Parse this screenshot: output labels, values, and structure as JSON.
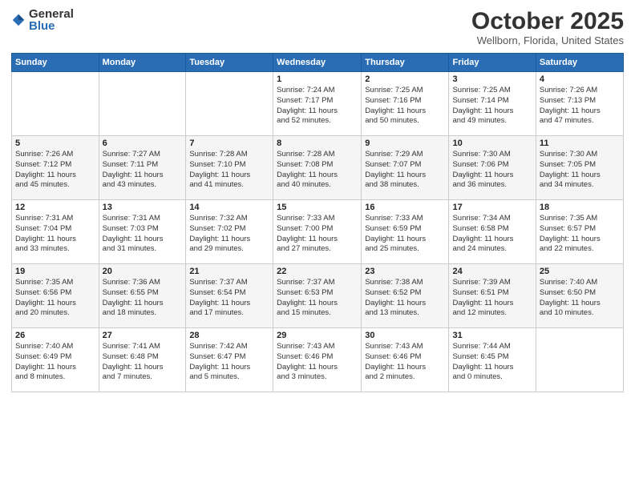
{
  "header": {
    "logo_general": "General",
    "logo_blue": "Blue",
    "month_title": "October 2025",
    "location": "Wellborn, Florida, United States"
  },
  "days_of_week": [
    "Sunday",
    "Monday",
    "Tuesday",
    "Wednesday",
    "Thursday",
    "Friday",
    "Saturday"
  ],
  "weeks": [
    {
      "cells": [
        {
          "day": "",
          "info": ""
        },
        {
          "day": "",
          "info": ""
        },
        {
          "day": "",
          "info": ""
        },
        {
          "day": "1",
          "info": "Sunrise: 7:24 AM\nSunset: 7:17 PM\nDaylight: 11 hours\nand 52 minutes."
        },
        {
          "day": "2",
          "info": "Sunrise: 7:25 AM\nSunset: 7:16 PM\nDaylight: 11 hours\nand 50 minutes."
        },
        {
          "day": "3",
          "info": "Sunrise: 7:25 AM\nSunset: 7:14 PM\nDaylight: 11 hours\nand 49 minutes."
        },
        {
          "day": "4",
          "info": "Sunrise: 7:26 AM\nSunset: 7:13 PM\nDaylight: 11 hours\nand 47 minutes."
        }
      ]
    },
    {
      "cells": [
        {
          "day": "5",
          "info": "Sunrise: 7:26 AM\nSunset: 7:12 PM\nDaylight: 11 hours\nand 45 minutes."
        },
        {
          "day": "6",
          "info": "Sunrise: 7:27 AM\nSunset: 7:11 PM\nDaylight: 11 hours\nand 43 minutes."
        },
        {
          "day": "7",
          "info": "Sunrise: 7:28 AM\nSunset: 7:10 PM\nDaylight: 11 hours\nand 41 minutes."
        },
        {
          "day": "8",
          "info": "Sunrise: 7:28 AM\nSunset: 7:08 PM\nDaylight: 11 hours\nand 40 minutes."
        },
        {
          "day": "9",
          "info": "Sunrise: 7:29 AM\nSunset: 7:07 PM\nDaylight: 11 hours\nand 38 minutes."
        },
        {
          "day": "10",
          "info": "Sunrise: 7:30 AM\nSunset: 7:06 PM\nDaylight: 11 hours\nand 36 minutes."
        },
        {
          "day": "11",
          "info": "Sunrise: 7:30 AM\nSunset: 7:05 PM\nDaylight: 11 hours\nand 34 minutes."
        }
      ]
    },
    {
      "cells": [
        {
          "day": "12",
          "info": "Sunrise: 7:31 AM\nSunset: 7:04 PM\nDaylight: 11 hours\nand 33 minutes."
        },
        {
          "day": "13",
          "info": "Sunrise: 7:31 AM\nSunset: 7:03 PM\nDaylight: 11 hours\nand 31 minutes."
        },
        {
          "day": "14",
          "info": "Sunrise: 7:32 AM\nSunset: 7:02 PM\nDaylight: 11 hours\nand 29 minutes."
        },
        {
          "day": "15",
          "info": "Sunrise: 7:33 AM\nSunset: 7:00 PM\nDaylight: 11 hours\nand 27 minutes."
        },
        {
          "day": "16",
          "info": "Sunrise: 7:33 AM\nSunset: 6:59 PM\nDaylight: 11 hours\nand 25 minutes."
        },
        {
          "day": "17",
          "info": "Sunrise: 7:34 AM\nSunset: 6:58 PM\nDaylight: 11 hours\nand 24 minutes."
        },
        {
          "day": "18",
          "info": "Sunrise: 7:35 AM\nSunset: 6:57 PM\nDaylight: 11 hours\nand 22 minutes."
        }
      ]
    },
    {
      "cells": [
        {
          "day": "19",
          "info": "Sunrise: 7:35 AM\nSunset: 6:56 PM\nDaylight: 11 hours\nand 20 minutes."
        },
        {
          "day": "20",
          "info": "Sunrise: 7:36 AM\nSunset: 6:55 PM\nDaylight: 11 hours\nand 18 minutes."
        },
        {
          "day": "21",
          "info": "Sunrise: 7:37 AM\nSunset: 6:54 PM\nDaylight: 11 hours\nand 17 minutes."
        },
        {
          "day": "22",
          "info": "Sunrise: 7:37 AM\nSunset: 6:53 PM\nDaylight: 11 hours\nand 15 minutes."
        },
        {
          "day": "23",
          "info": "Sunrise: 7:38 AM\nSunset: 6:52 PM\nDaylight: 11 hours\nand 13 minutes."
        },
        {
          "day": "24",
          "info": "Sunrise: 7:39 AM\nSunset: 6:51 PM\nDaylight: 11 hours\nand 12 minutes."
        },
        {
          "day": "25",
          "info": "Sunrise: 7:40 AM\nSunset: 6:50 PM\nDaylight: 11 hours\nand 10 minutes."
        }
      ]
    },
    {
      "cells": [
        {
          "day": "26",
          "info": "Sunrise: 7:40 AM\nSunset: 6:49 PM\nDaylight: 11 hours\nand 8 minutes."
        },
        {
          "day": "27",
          "info": "Sunrise: 7:41 AM\nSunset: 6:48 PM\nDaylight: 11 hours\nand 7 minutes."
        },
        {
          "day": "28",
          "info": "Sunrise: 7:42 AM\nSunset: 6:47 PM\nDaylight: 11 hours\nand 5 minutes."
        },
        {
          "day": "29",
          "info": "Sunrise: 7:43 AM\nSunset: 6:46 PM\nDaylight: 11 hours\nand 3 minutes."
        },
        {
          "day": "30",
          "info": "Sunrise: 7:43 AM\nSunset: 6:46 PM\nDaylight: 11 hours\nand 2 minutes."
        },
        {
          "day": "31",
          "info": "Sunrise: 7:44 AM\nSunset: 6:45 PM\nDaylight: 11 hours\nand 0 minutes."
        },
        {
          "day": "",
          "info": ""
        }
      ]
    }
  ]
}
